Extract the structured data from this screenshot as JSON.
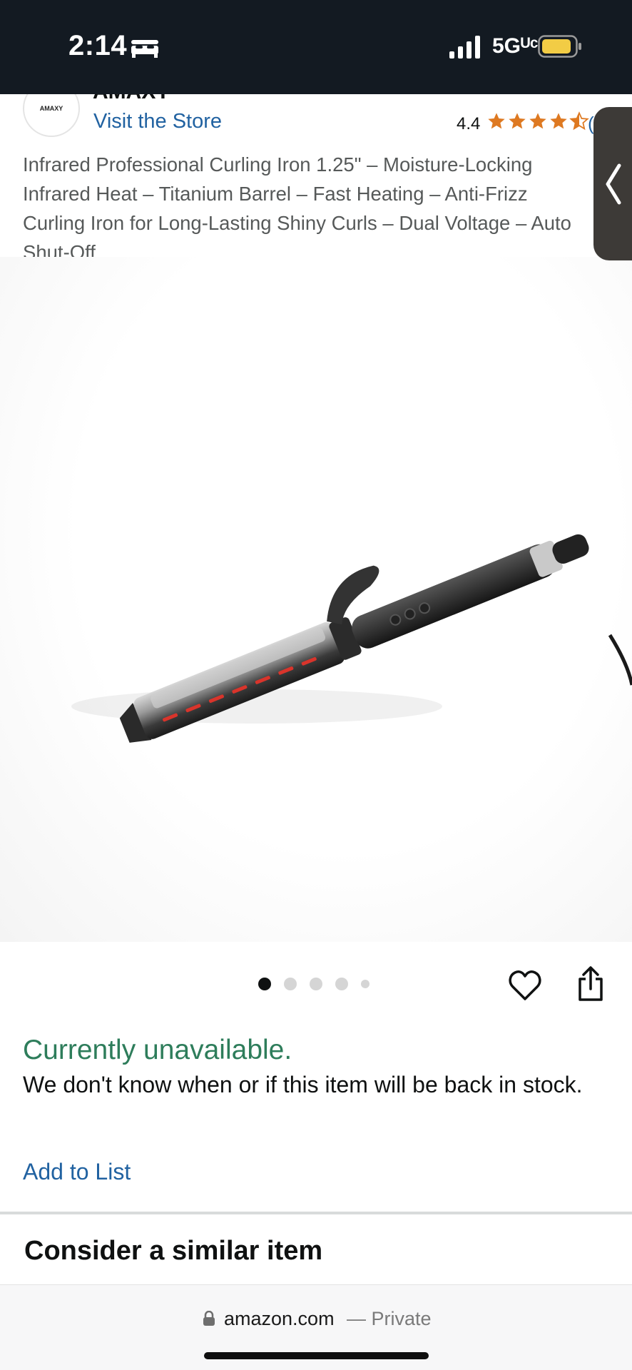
{
  "status_bar": {
    "time": "2:14",
    "network": "5Gᵁᶜ",
    "icons": [
      "bed-icon",
      "signal-icon",
      "battery-icon"
    ]
  },
  "product": {
    "brand_logo_text": "AMAXY",
    "brand_name": "AMAXY",
    "visit_store": "Visit the Store",
    "rating": "4.4",
    "rating_count": "(",
    "stars_filled": 4.5,
    "title": "Infrared Professional Curling Iron 1.25\" – Moisture-Locking Infrared Heat – Titanium Barrel – Fast Heating – Anti-Frizz Curling Iron for Long-Lasting Shiny Curls – Dual Voltage – Auto Shut-Off",
    "image_count": 5,
    "current_image": 1
  },
  "availability": {
    "status": "Currently unavailable.",
    "note": "We don't know when or if this item will be back in stock."
  },
  "actions": {
    "add_to_list": "Add to List"
  },
  "similar": {
    "heading": "Consider a similar item"
  },
  "browser": {
    "domain": "amazon.com",
    "private_label": "— Private"
  },
  "colors": {
    "status_bar_bg": "#131a22",
    "link": "#2162a1",
    "availability_green": "#2e7d5b",
    "star": "#de7921",
    "battery_fill": "#f2cc45"
  }
}
